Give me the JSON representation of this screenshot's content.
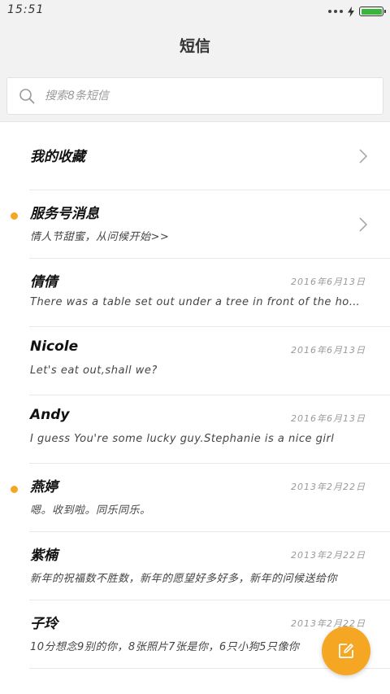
{
  "status_bar": {
    "time": "15:51",
    "battery_color": "#3bb43b"
  },
  "header": {
    "title": "短信"
  },
  "search": {
    "placeholder": "搜索8条短信"
  },
  "accent_color": "#f5a623",
  "list": {
    "favorites": {
      "name": "我的收藏"
    },
    "service": {
      "name": "服务号消息",
      "preview": "情人节甜蜜，从问候开始>>",
      "unread": true
    },
    "conversations": [
      {
        "name": "倩倩",
        "date": "2016年6月13日",
        "preview": "There was a table set out under a tree in front of the house, and the March Hare and the Hatter were having tea at it",
        "unread": false
      },
      {
        "name": "Nicole",
        "date": "2016年6月13日",
        "preview": "Let's eat out,shall we?",
        "unread": false
      },
      {
        "name": "Andy",
        "date": "2016年6月13日",
        "preview": "I guess You're some lucky guy.Stephanie is a nice girl",
        "unread": false
      },
      {
        "name": "燕婷",
        "date": "2013年2月22日",
        "preview": "嗯。收到啦。同乐同乐。",
        "unread": true
      },
      {
        "name": "紫楠",
        "date": "2013年2月22日",
        "preview": "新年的祝福数不胜数，新年的愿望好多好多，新年的问候送给你",
        "unread": false
      },
      {
        "name": "子玲",
        "date": "2013年2月22日",
        "preview": "10分想念9别的你，8张照片7张是你，6只小狗5只像你",
        "unread": false
      }
    ]
  },
  "fab": {
    "icon": "compose-icon"
  }
}
